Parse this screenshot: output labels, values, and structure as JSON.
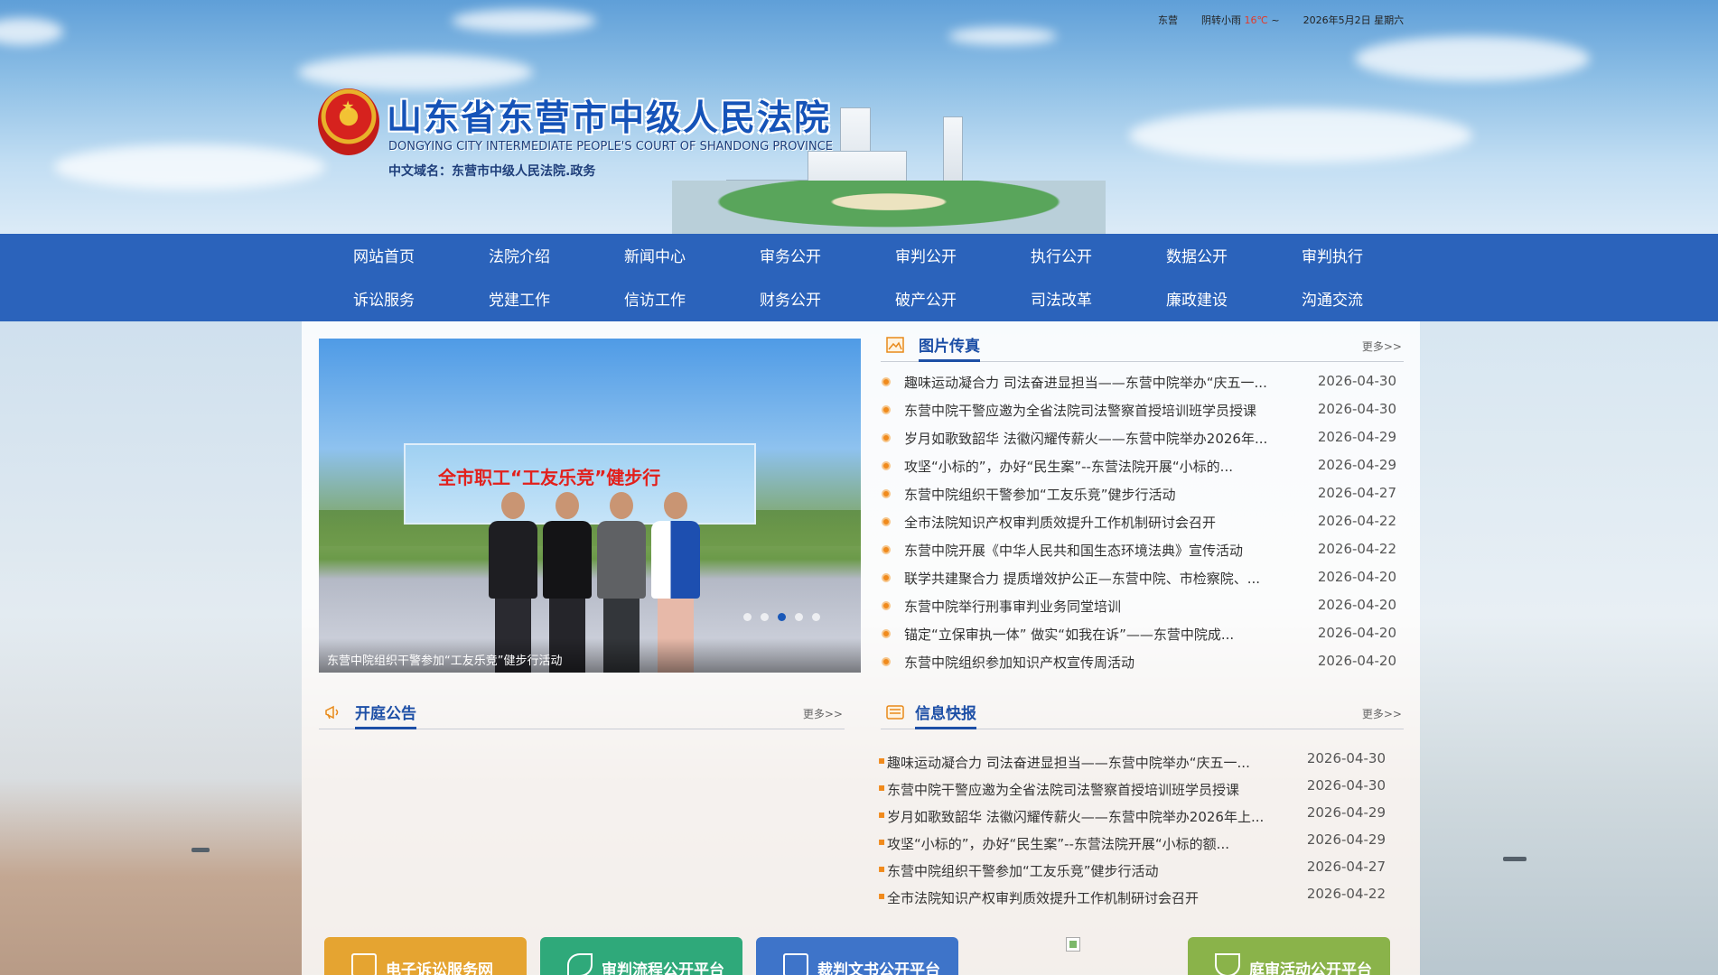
{
  "header": {
    "city": "东营",
    "weather": "阴转小雨",
    "temperature": "16℃",
    "temp_suffix": "~",
    "date": "2026年5月2日",
    "weekday": "星期六",
    "title": "山东省东营市中级人民法院",
    "title_en": "DONGYING CITY INTERMEDIATE PEOPLE'S COURT OF SHANDONG PROVINCE",
    "domain": "中文域名：东营市中级人民法院.政务"
  },
  "nav": {
    "row1": [
      "网站首页",
      "法院介绍",
      "新闻中心",
      "审务公开",
      "审判公开",
      "执行公开",
      "数据公开",
      "审判执行"
    ],
    "row2": [
      "诉讼服务",
      "党建工作",
      "信访工作",
      "财务公开",
      "破产公开",
      "司法改革",
      "廉政建设",
      "沟通交流"
    ]
  },
  "slideshow": {
    "banner_text": "全市职工“工友乐竞”健步行",
    "caption": "东营中院组织干警参加“工友乐竞”健步行活动",
    "dot_count": 5,
    "active_dot": 2
  },
  "photo_news": {
    "title": "图片传真",
    "more": "更多>>",
    "items": [
      {
        "title": "趣味运动凝合力 司法奋进显担当——东营中院举办“庆五一...",
        "date": "2026-04-30"
      },
      {
        "title": "东营中院干警应邀为全省法院司法警察首授培训班学员授课",
        "date": "2026-04-30"
      },
      {
        "title": "岁月如歌致韶华 法徽闪耀传薪火——东营中院举办2026年...",
        "date": "2026-04-29"
      },
      {
        "title": "攻坚“小标的”，办好“民生案”--东营法院开展“小标的...",
        "date": "2026-04-29"
      },
      {
        "title": "东营中院组织干警参加“工友乐竞”健步行活动",
        "date": "2026-04-27"
      },
      {
        "title": "全市法院知识产权审判质效提升工作机制研讨会召开",
        "date": "2026-04-22"
      },
      {
        "title": "东营中院开展《中华人民共和国生态环境法典》宣传活动",
        "date": "2026-04-22"
      },
      {
        "title": "联学共建聚合力 提质增效护公正—东营中院、市检察院、...",
        "date": "2026-04-20"
      },
      {
        "title": "东营中院举行刑事审判业务同堂培训",
        "date": "2026-04-20"
      },
      {
        "title": "锚定“立保审执一体” 做实“如我在诉”——东营中院成...",
        "date": "2026-04-20"
      },
      {
        "title": "东营中院组织参加知识产权宣传周活动",
        "date": "2026-04-20"
      }
    ]
  },
  "court_notice": {
    "title": "开庭公告",
    "more": "更多>>"
  },
  "info_news": {
    "title": "信息快报",
    "more": "更多>>",
    "items": [
      {
        "title": "趣味运动凝合力 司法奋进显担当——东营中院举办“庆五一...",
        "date": "2026-04-30"
      },
      {
        "title": "东营中院干警应邀为全省法院司法警察首授培训班学员授课",
        "date": "2026-04-30"
      },
      {
        "title": "岁月如歌致韶华 法徽闪耀传薪火——东营中院举办2026年上...",
        "date": "2026-04-29"
      },
      {
        "title": "攻坚“小标的”，办好“民生案”--东营法院开展“小标的额...",
        "date": "2026-04-29"
      },
      {
        "title": "东营中院组织干警参加“工友乐竞”健步行活动",
        "date": "2026-04-27"
      },
      {
        "title": "全市法院知识产权审判质效提升工作机制研讨会召开",
        "date": "2026-04-22"
      }
    ]
  },
  "platforms": [
    {
      "label": "电子诉讼服务网",
      "color": "#e5a431"
    },
    {
      "label": "审判流程公开平台",
      "color": "#2fa97a"
    },
    {
      "label": "裁判文书公开平台",
      "color": "#3e74c9"
    },
    {
      "label": "庭审活动公开平台",
      "color": "#8ab34a"
    }
  ]
}
